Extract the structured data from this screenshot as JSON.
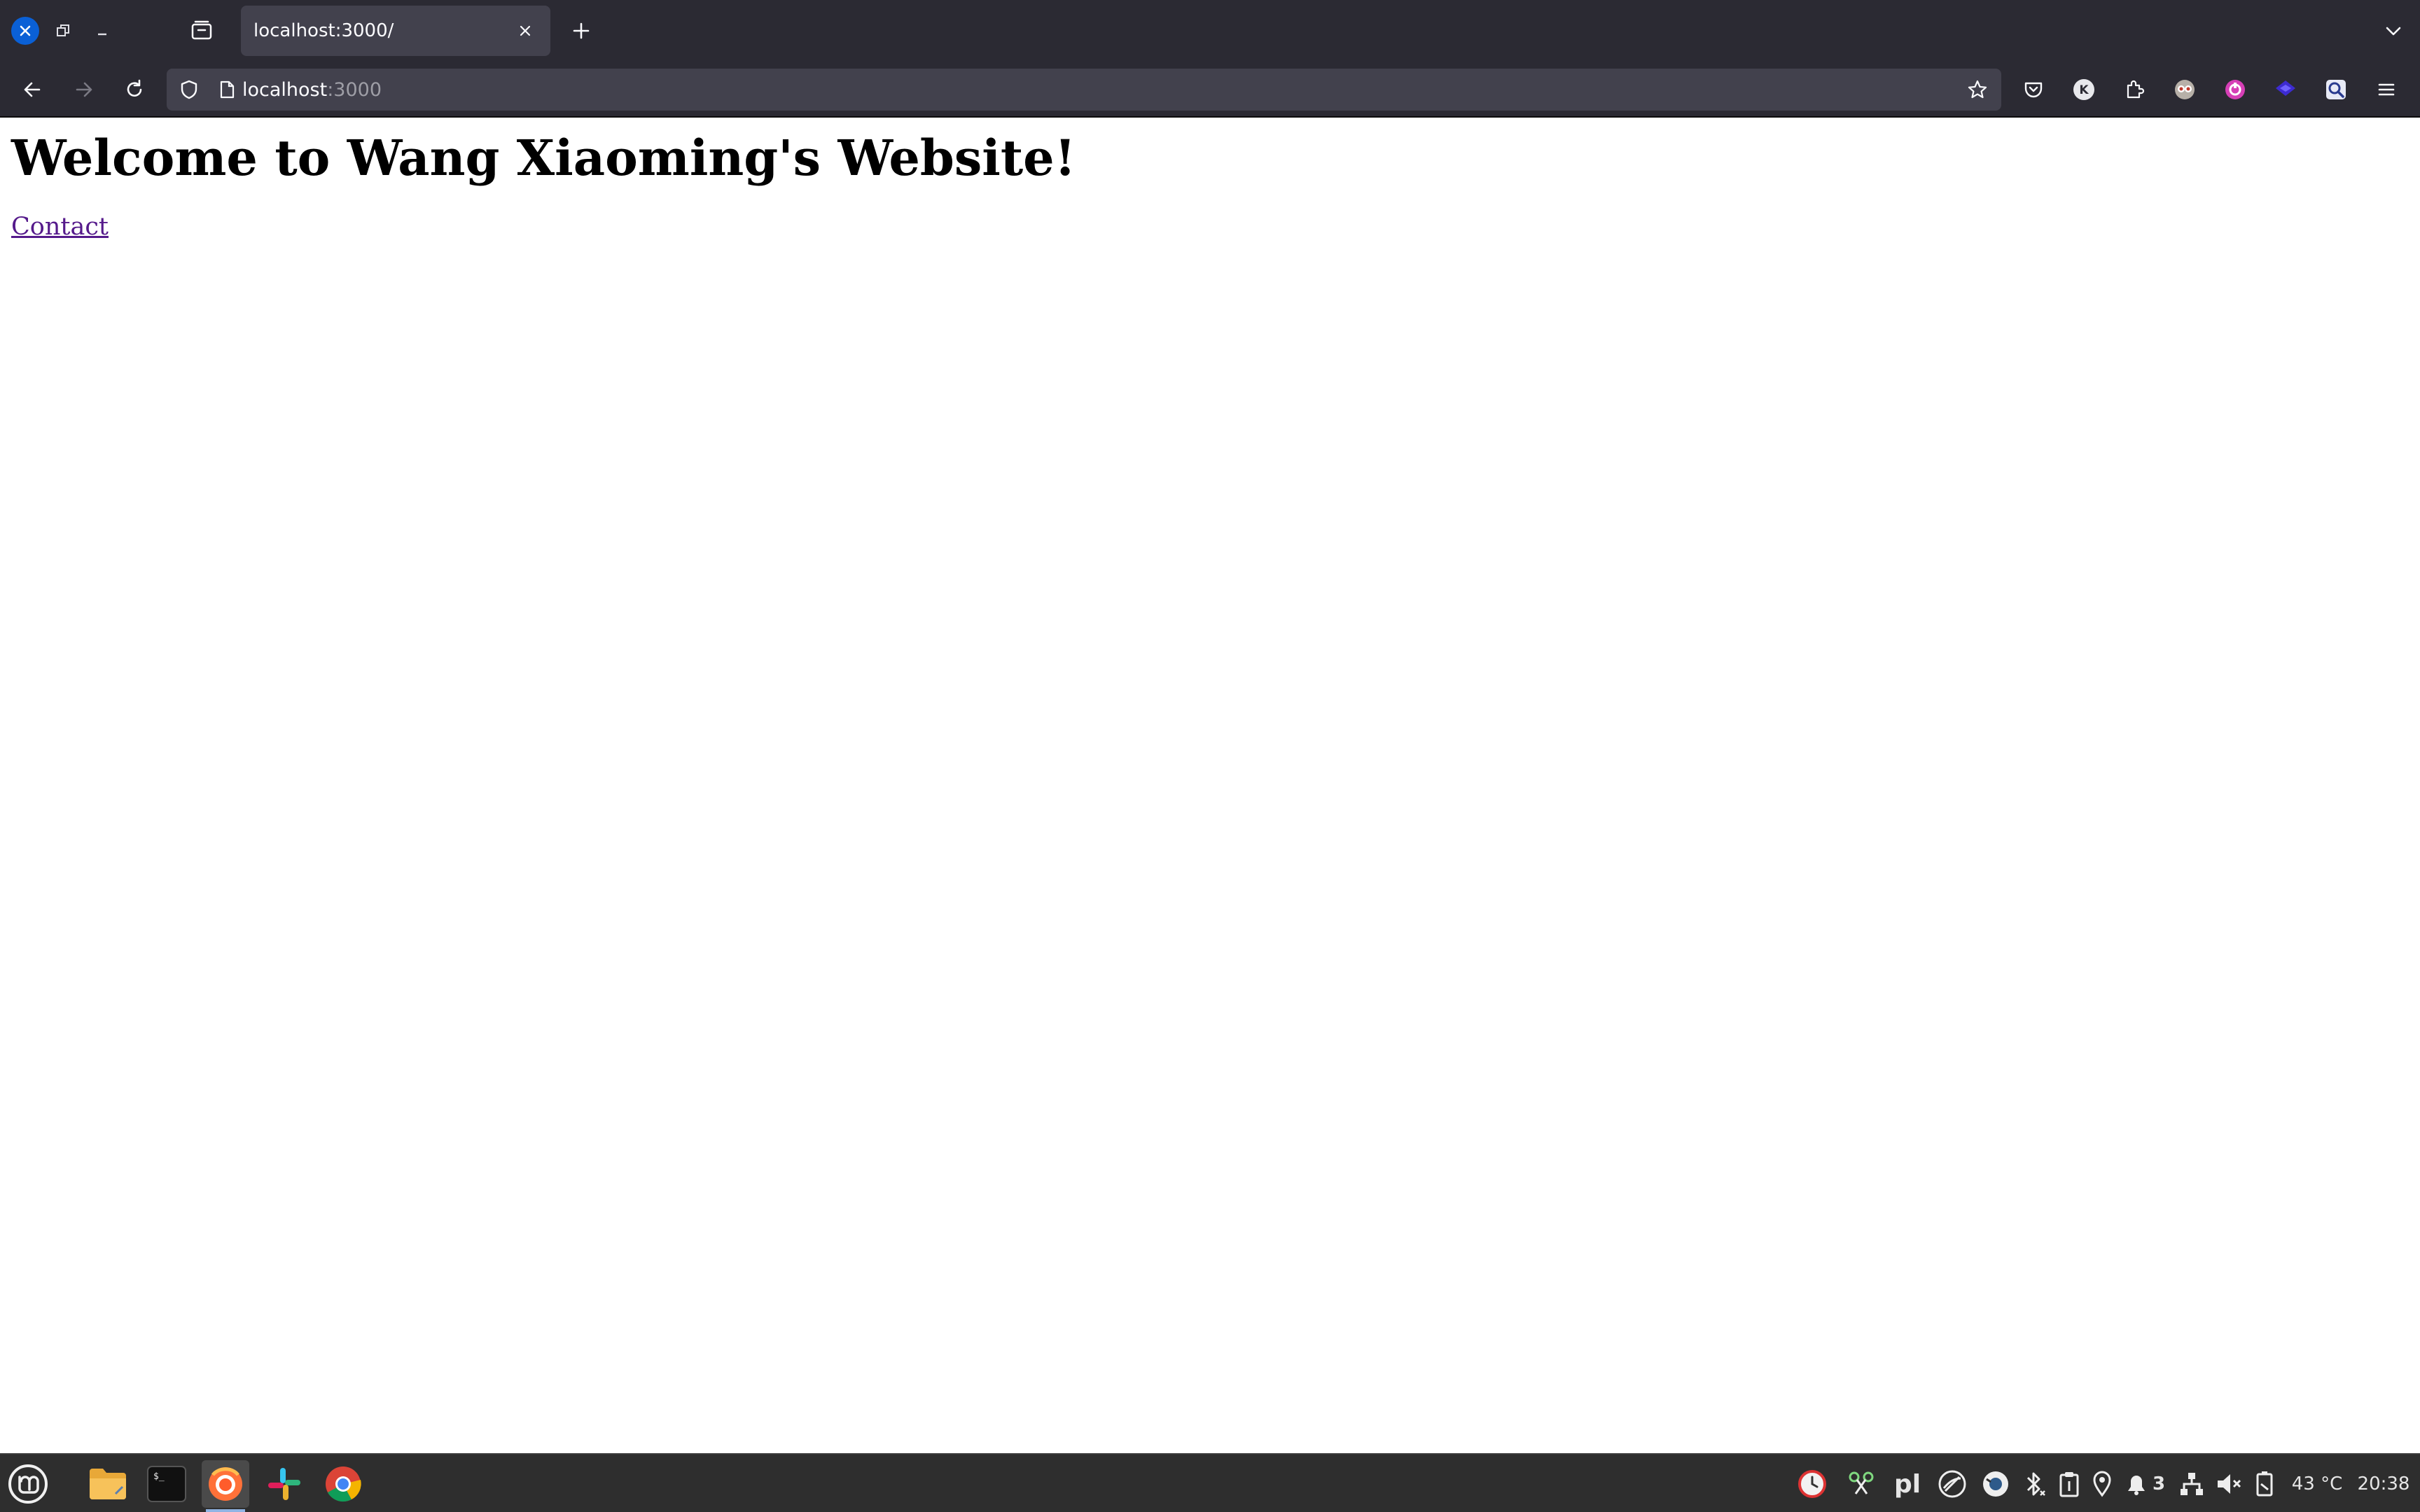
{
  "window": {
    "close_icon": "close-icon",
    "restore_icon": "restore-icon",
    "minimize_icon": "minimize-icon"
  },
  "tabs": [
    {
      "label": "localhost:3000/",
      "active": true
    }
  ],
  "toolbar": {
    "url_host": "localhost",
    "url_port": ":3000"
  },
  "page": {
    "heading": "Welcome to Wang Xiaoming's Website!",
    "link": "Contact"
  },
  "taskbar": {
    "apps": [
      "mint-menu-icon",
      "files-icon",
      "terminal-icon",
      "firefox-icon",
      "slack-icon",
      "chrome-icon"
    ],
    "tray": {
      "pl_label": "pl",
      "notification_count": "3",
      "temperature": "43 °C",
      "time": "20:38"
    }
  },
  "colors": {
    "chrome_bg": "#2b2a33",
    "tab_active_bg": "#42414d",
    "close_blue": "#0a60d6",
    "link_visited": "#551a8b",
    "taskbar_bg": "#2e2e2e"
  }
}
